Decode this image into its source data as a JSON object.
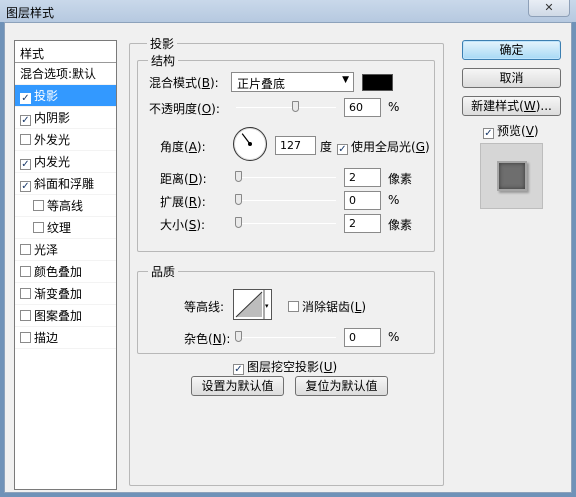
{
  "window": {
    "title": "图层样式",
    "close_icon": "close-icon"
  },
  "sidebar": {
    "header": "样式",
    "items": [
      {
        "label": "混合选项:默认",
        "checkbox": false,
        "checked": false,
        "sub": false,
        "selected": false
      },
      {
        "label": "投影",
        "checkbox": true,
        "checked": true,
        "sub": false,
        "selected": true
      },
      {
        "label": "内阴影",
        "checkbox": true,
        "checked": true,
        "sub": false,
        "selected": false
      },
      {
        "label": "外发光",
        "checkbox": true,
        "checked": false,
        "sub": false,
        "selected": false
      },
      {
        "label": "内发光",
        "checkbox": true,
        "checked": true,
        "sub": false,
        "selected": false
      },
      {
        "label": "斜面和浮雕",
        "checkbox": true,
        "checked": true,
        "sub": false,
        "selected": false
      },
      {
        "label": "等高线",
        "checkbox": true,
        "checked": false,
        "sub": true,
        "selected": false
      },
      {
        "label": "纹理",
        "checkbox": true,
        "checked": false,
        "sub": true,
        "selected": false
      },
      {
        "label": "光泽",
        "checkbox": true,
        "checked": false,
        "sub": false,
        "selected": false
      },
      {
        "label": "颜色叠加",
        "checkbox": true,
        "checked": false,
        "sub": false,
        "selected": false
      },
      {
        "label": "渐变叠加",
        "checkbox": true,
        "checked": false,
        "sub": false,
        "selected": false
      },
      {
        "label": "图案叠加",
        "checkbox": true,
        "checked": false,
        "sub": false,
        "selected": false
      },
      {
        "label": "描边",
        "checkbox": true,
        "checked": false,
        "sub": false,
        "selected": false
      }
    ]
  },
  "panel": {
    "title": "投影",
    "structure": {
      "legend": "结构",
      "blend_mode_label": "混合模式",
      "blend_mode_key": "B",
      "blend_mode_value": "正片叠底",
      "shadow_color": "#000000",
      "opacity_label": "不透明度",
      "opacity_key": "O",
      "opacity_value": "60",
      "opacity_unit": "%",
      "opacity_level": 0.6,
      "angle_label": "角度",
      "angle_key": "A",
      "angle_value": "127",
      "angle_unit": "度",
      "global_light_label": "使用全局光",
      "global_light_key": "G",
      "global_light_checked": true,
      "distance_label": "距离",
      "distance_key": "D",
      "distance_value": "2",
      "distance_unit": "像素",
      "spread_label": "扩展",
      "spread_key": "R",
      "spread_value": "0",
      "spread_unit": "%",
      "size_label": "大小",
      "size_key": "S",
      "size_value": "2",
      "size_unit": "像素"
    },
    "quality": {
      "legend": "品质",
      "contour_label": "等高线",
      "antialias_label": "消除锯齿",
      "antialias_key": "L",
      "antialias_checked": false,
      "noise_label": "杂色",
      "noise_key": "N",
      "noise_value": "0",
      "noise_unit": "%"
    },
    "knockout_label": "图层挖空投影",
    "knockout_key": "U",
    "knockout_checked": true,
    "set_default_label": "设置为默认值",
    "reset_default_label": "复位为默认值"
  },
  "actions": {
    "ok_label": "确定",
    "cancel_label": "取消",
    "new_style_label": "新建样式",
    "new_style_key": "W",
    "preview_label": "预览",
    "preview_key": "V",
    "preview_checked": true
  },
  "colors": {
    "accent": "#3399ff",
    "window_frame": "#6f92b8"
  }
}
